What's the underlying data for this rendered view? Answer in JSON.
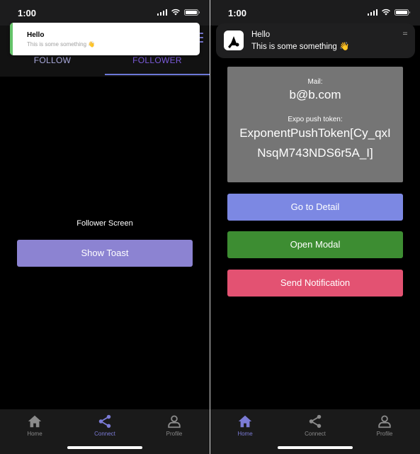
{
  "left_screen": {
    "status": {
      "time": "1:00"
    },
    "toast": {
      "title": "Hello",
      "body": "This is some something 👋"
    },
    "tabs": {
      "follow": "FOLLOW",
      "follower": "FOLLOWER",
      "active": "FOLLOWER"
    },
    "content": {
      "label": "Follower Screen",
      "show_toast_button": "Show Toast"
    },
    "bottom_tabs": [
      {
        "label": "Home",
        "icon": "home-icon",
        "active": false
      },
      {
        "label": "Connect",
        "icon": "share-icon",
        "active": true
      },
      {
        "label": "Profile",
        "icon": "profile-icon",
        "active": false
      }
    ]
  },
  "right_screen": {
    "status": {
      "time": "1:00"
    },
    "notification": {
      "title": "Hello",
      "body": "This is some something 👋",
      "app_icon": "app-logo-icon"
    },
    "info_card": {
      "mail_label": "Mail:",
      "mail_value": "b@b.com",
      "token_label": "Expo push token:",
      "token_value": "ExponentPushToken[Cy_qxINsqM743NDS6r5A_I]"
    },
    "buttons": {
      "go_to_detail": "Go to Detail",
      "open_modal": "Open Modal",
      "send_notification": "Send Notification"
    },
    "bottom_tabs": [
      {
        "label": "Home",
        "icon": "home-icon",
        "active": true
      },
      {
        "label": "Connect",
        "icon": "share-icon",
        "active": false
      },
      {
        "label": "Profile",
        "icon": "profile-icon",
        "active": false
      }
    ]
  },
  "colors": {
    "accent": "#7b7bd6",
    "toast_accent": "#65c46a",
    "button_detail": "#7c88e3",
    "button_modal": "#3d8d32",
    "button_notify": "#e35272",
    "inactive_tab": "#8a8a8a"
  }
}
